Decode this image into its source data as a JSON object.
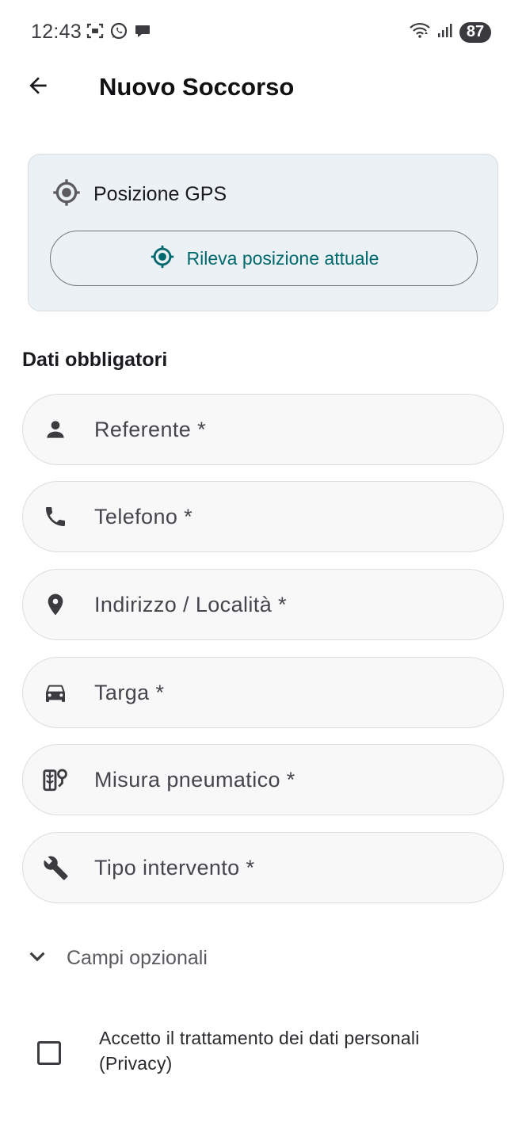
{
  "status_bar": {
    "time": "12:43",
    "battery": "87",
    "left_icons": [
      "screenshot-icon",
      "whatsapp-icon",
      "chat-bubble-icon"
    ],
    "right_icons": [
      "wifi-icon",
      "signal-icon",
      "battery-icon"
    ]
  },
  "app_bar": {
    "title": "Nuovo Soccorso",
    "back_icon": "arrow-back-icon"
  },
  "gps_card": {
    "title": "Posizione GPS",
    "button_label": "Rileva posizione attuale",
    "accent_color": "#00696d"
  },
  "section": {
    "title": "Dati obbligatori"
  },
  "fields": [
    {
      "icon": "person-icon",
      "placeholder": "Referente *"
    },
    {
      "icon": "phone-icon",
      "placeholder": "Telefono *"
    },
    {
      "icon": "location-pin-icon",
      "placeholder": "Indirizzo / Località *"
    },
    {
      "icon": "car-icon",
      "placeholder": "Targa *"
    },
    {
      "icon": "tire-measure-icon",
      "placeholder": "Misura pneumatico *"
    },
    {
      "icon": "wrench-icon",
      "placeholder": "Tipo intervento *"
    }
  ],
  "optional": {
    "label": "Campi opzionali",
    "icon": "chevron-down-icon"
  },
  "privacy": {
    "label": "Accetto il trattamento dei dati personali (Privacy)",
    "checked": false
  }
}
